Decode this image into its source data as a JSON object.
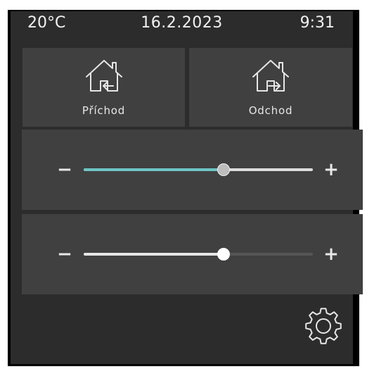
{
  "status": {
    "temperature": "20°C",
    "date": "16.2.2023",
    "time": "9:31"
  },
  "buttons": {
    "arrive": {
      "label": "Příchod",
      "icon": "house-arrive-icon"
    },
    "leave": {
      "label": "Odchod",
      "icon": "house-leave-icon"
    }
  },
  "sliders": [
    {
      "minus": "−",
      "plus": "+",
      "value": 0.61,
      "active": true,
      "fill_color": "#6fc6c6"
    },
    {
      "minus": "−",
      "plus": "+",
      "value": 0.61,
      "active": false,
      "fill_color": "#e6e6e6"
    }
  ],
  "settings": {
    "icon": "gear-icon"
  }
}
